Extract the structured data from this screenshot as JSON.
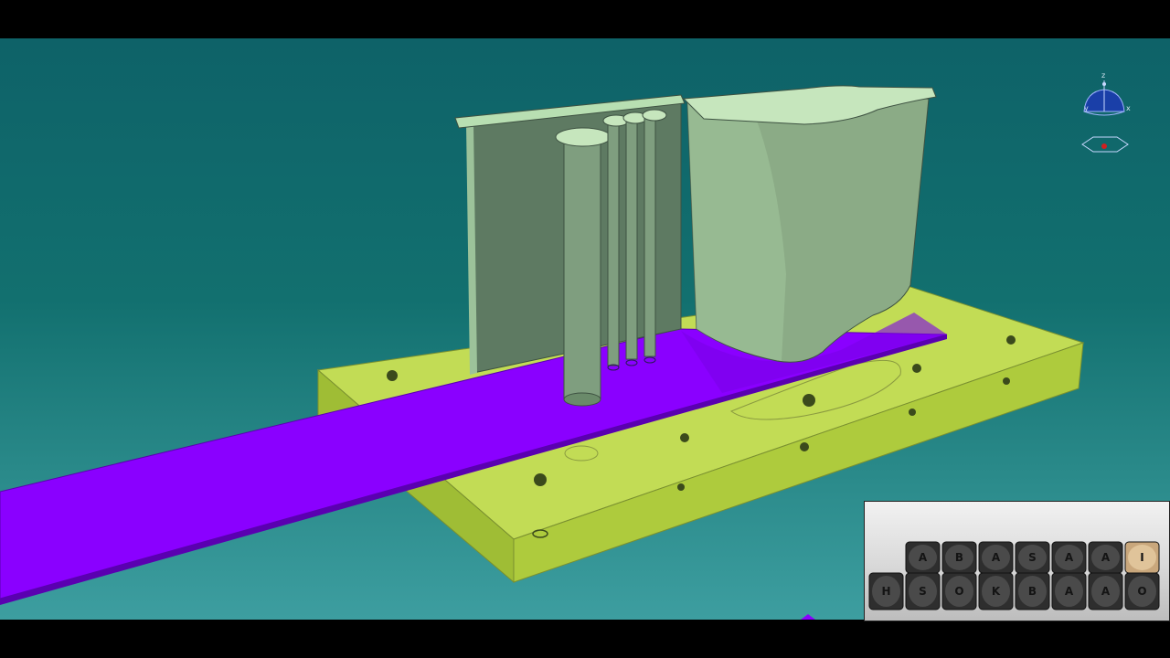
{
  "viewer": {
    "background_top": "#0e6268",
    "background_bottom": "#3d9ea0"
  },
  "model": {
    "colors": {
      "base_plate": "#b8d44a",
      "strip": "#8a00ff",
      "die_parts": "#8fae86"
    }
  },
  "compass": {
    "axis_x": "x",
    "axis_y": "y",
    "axis_z": "z"
  },
  "inset": {
    "top_row_letters": [
      "A",
      "B",
      "A",
      "S",
      "A",
      "A",
      "I"
    ],
    "bottom_row_letters": [
      "H",
      "S",
      "O",
      "K",
      "B",
      "A",
      "A",
      "O"
    ]
  }
}
